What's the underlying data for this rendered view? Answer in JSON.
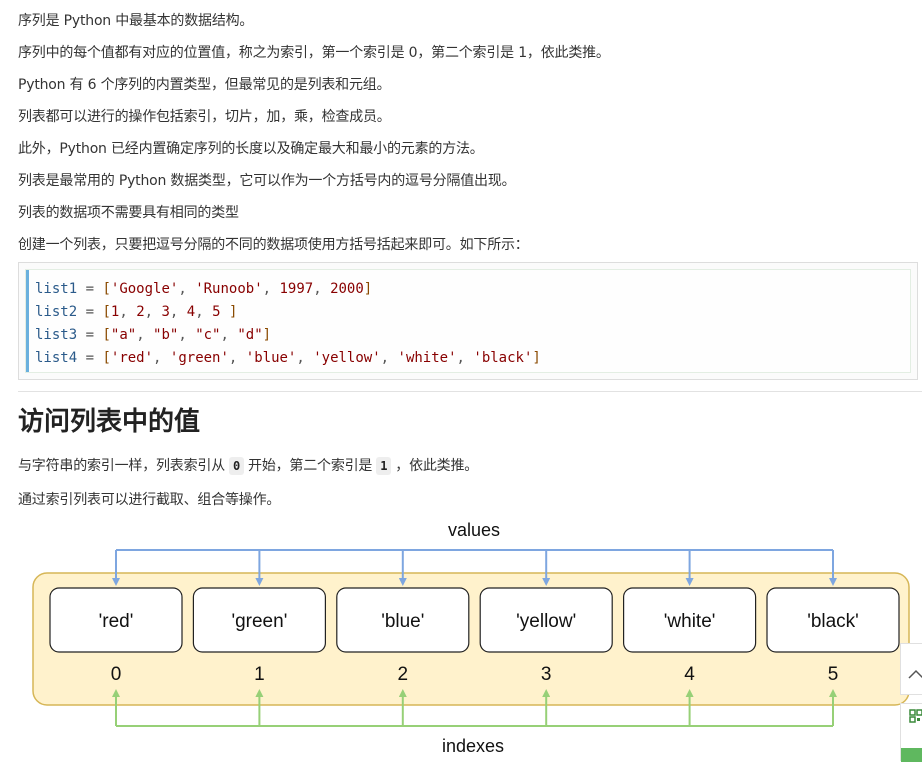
{
  "paragraphs": [
    "序列是 Python 中最基本的数据结构。",
    "序列中的每个值都有对应的位置值，称之为索引，第一个索引是 0，第二个索引是 1，依此类推。",
    "Python 有 6 个序列的内置类型，但最常见的是列表和元组。",
    "列表都可以进行的操作包括索引，切片，加，乘，检查成员。",
    "此外，Python 已经内置确定序列的长度以及确定最大和最小的元素的方法。",
    "列表是最常用的 Python 数据类型，它可以作为一个方括号内的逗号分隔值出现。",
    "列表的数据项不需要具有相同的类型",
    "创建一个列表，只要把逗号分隔的不同的数据项使用方括号括起来即可。如下所示："
  ],
  "code": {
    "lines": [
      {
        "var": "list1",
        "items": [
          {
            "t": "str",
            "v": "'Google'"
          },
          {
            "t": "str",
            "v": "'Runoob'"
          },
          {
            "t": "num",
            "v": "1997"
          },
          {
            "t": "num",
            "v": "2000"
          }
        ],
        "closing_space": false
      },
      {
        "var": "list2",
        "items": [
          {
            "t": "num",
            "v": "1"
          },
          {
            "t": "num",
            "v": "2"
          },
          {
            "t": "num",
            "v": "3"
          },
          {
            "t": "num",
            "v": "4"
          },
          {
            "t": "num",
            "v": "5"
          }
        ],
        "closing_space": true
      },
      {
        "var": "list3",
        "items": [
          {
            "t": "str",
            "v": "\"a\""
          },
          {
            "t": "str",
            "v": "\"b\""
          },
          {
            "t": "str",
            "v": "\"c\""
          },
          {
            "t": "str",
            "v": "\"d\""
          }
        ],
        "closing_space": false
      },
      {
        "var": "list4",
        "items": [
          {
            "t": "str",
            "v": "'red'"
          },
          {
            "t": "str",
            "v": "'green'"
          },
          {
            "t": "str",
            "v": "'blue'"
          },
          {
            "t": "str",
            "v": "'yellow'"
          },
          {
            "t": "str",
            "v": "'white'"
          },
          {
            "t": "str",
            "v": "'black'"
          }
        ],
        "closing_space": false
      }
    ]
  },
  "section": {
    "heading": "访问列表中的值",
    "p1_before": "与字符串的索引一样，列表索引从",
    "p1_code1": "0",
    "p1_middle": "开始，第二个索引是",
    "p1_code2": "1",
    "p1_after": "，依此类推。",
    "p2": "通过索引列表可以进行截取、组合等操作。"
  },
  "diagram": {
    "top_label": "values",
    "bottom_label": "indexes",
    "values": [
      "'red'",
      "'green'",
      "'blue'",
      "'yellow'",
      "'white'",
      "'black'"
    ],
    "indexes": [
      "0",
      "1",
      "2",
      "3",
      "4",
      "5"
    ],
    "colors": {
      "panel_fill": "#fff2cc",
      "panel_stroke": "#d6b656",
      "box_fill": "#ffffff",
      "box_stroke": "#222222",
      "values_arrow": "#7ea6e0",
      "indexes_arrow": "#97d077"
    }
  },
  "sidebar_icons": [
    "chevron-up-icon",
    "qr-code-icon"
  ]
}
